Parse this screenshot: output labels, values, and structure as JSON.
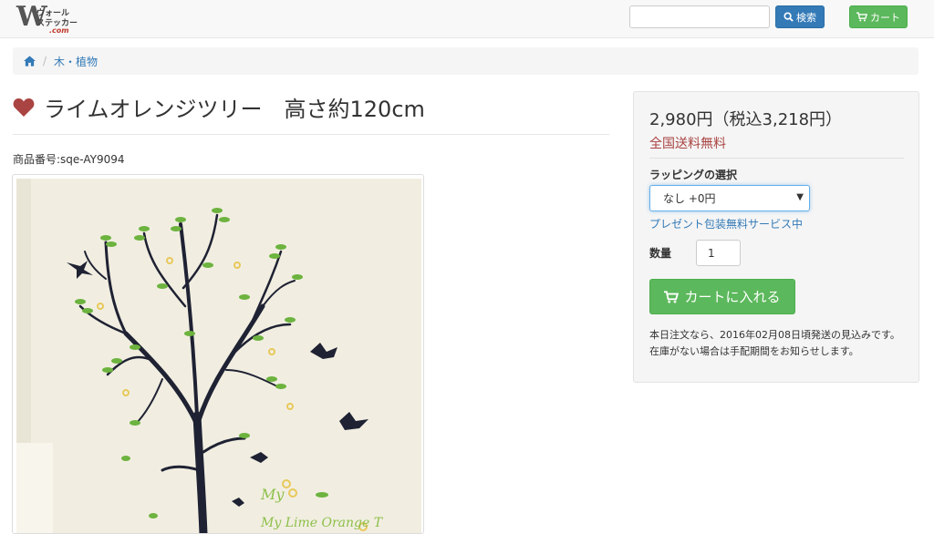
{
  "header": {
    "logo": {
      "letter": "W",
      "line1": "ウォール",
      "line2": "ステッカー",
      "line3": ".com"
    },
    "search": {
      "value": "",
      "button_label": "検索",
      "icon": "search-icon"
    },
    "cart": {
      "label": "カート",
      "icon": "cart-icon"
    }
  },
  "breadcrumb": {
    "home_icon": "home-icon",
    "items": [
      {
        "label": "木・植物"
      }
    ]
  },
  "product": {
    "favorite_icon": "heart-icon",
    "title": "ライムオレンジツリー　高さ約120cm",
    "code": "商品番号:sqe-AY9094",
    "image_caption": "My Lime Orange T"
  },
  "purchase": {
    "price": "2,980円（税込3,218円）",
    "shipping": "全国送料無料",
    "wrapping_label": "ラッピングの選択",
    "wrapping_selected": "なし +0円",
    "gift_note": "プレゼント包装無料サービス中",
    "quantity_label": "数量",
    "quantity_value": "1",
    "add_to_cart_label": "カートに入れる",
    "shipping_note": "本日注文なら、2016年02月08日頃発送の見込みです。在庫がない場合は手配期間をお知らせします。"
  },
  "colors": {
    "primary": "#337ab7",
    "success": "#5cb85c",
    "danger": "#a94442",
    "heart": "#a94442",
    "tree": "#1f2233",
    "leaf": "#6db33f",
    "fruit": "#e8c85a",
    "caption": "#8dbf4a"
  }
}
